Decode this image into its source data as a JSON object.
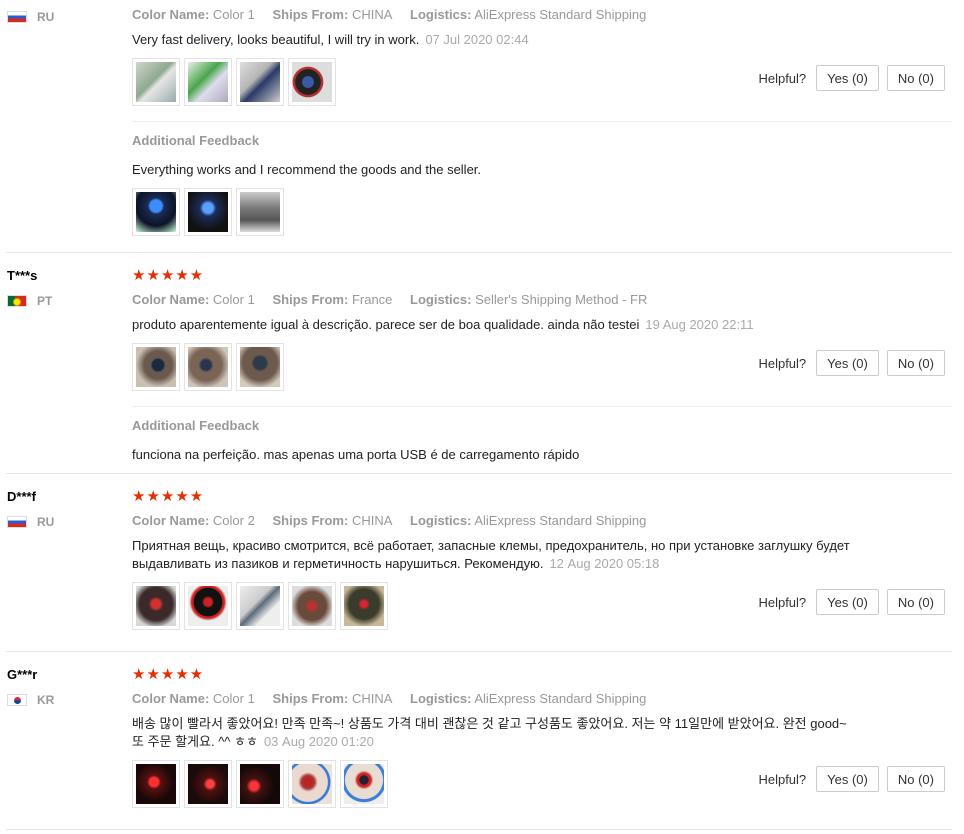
{
  "labels": {
    "color_name": "Color Name:",
    "ships_from": "Ships From:",
    "logistics": "Logistics:",
    "helpful": "Helpful?",
    "yes": "Yes (0)",
    "no": "No (0)",
    "additional_feedback": "Additional Feedback"
  },
  "rating_stars": "★★★★★",
  "reviews": [
    {
      "user": "",
      "country": "RU",
      "color": "Color 1",
      "ships_from": "CHINA",
      "logistics": "AliExpress Standard Shipping",
      "text": "Very fast delivery, looks beautiful, I will try in work.",
      "date": "07 Jul 2020 02:44",
      "photo_count": 4,
      "additional_feedback": "Everything works and I recommend the goods and the seller.",
      "additional_photo_count": 3
    },
    {
      "user": "T***s",
      "country": "PT",
      "rating": 5,
      "color": "Color 1",
      "ships_from": "France",
      "logistics": "Seller's Shipping Method - FR",
      "text": "produto aparentemente igual à descrição. parece ser de boa qualidade. ainda não testei",
      "date": "19 Aug 2020 22:11",
      "photo_count": 3,
      "additional_feedback": "funciona na perfeição. mas apenas uma porta USB é de carregamento rápido"
    },
    {
      "user": "D***f",
      "country": "RU",
      "rating": 5,
      "color": "Color 2",
      "ships_from": "CHINA",
      "logistics": "AliExpress Standard Shipping",
      "text": "Приятная вещь, красиво смотрится, всё работает, запасные клемы, предохранитель, но при установке заглушку будет выдавливать из пазиков и герметичность нарушиться. Рекомендую.",
      "date": "12 Aug 2020 05:18",
      "photo_count": 5
    },
    {
      "user": "G***r",
      "country": "KR",
      "rating": 5,
      "color": "Color 1",
      "ships_from": "CHINA",
      "logistics": "AliExpress Standard Shipping",
      "text": "배송 많이 빨라서 좋았어요! 만족 만족~! 상품도 가격 대비 괜찮은 것 같고 구성품도 좋았어요. 저는 약 11일만에 받았어요. 완전 good~ 또 주문 할게요. ^^ ㅎㅎ",
      "date": "03 Aug 2020 01:20",
      "photo_count": 5
    }
  ]
}
